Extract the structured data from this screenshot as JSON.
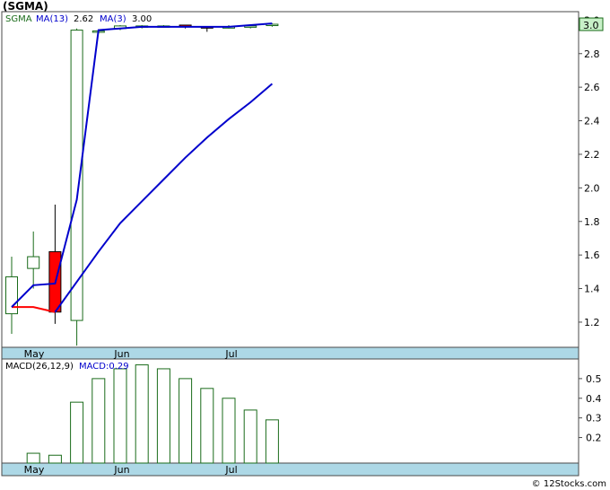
{
  "title": "(SGMA)",
  "footer": "© 12Stocks.com",
  "colors": {
    "up_candle": "#1a6b1a",
    "down_candle": "#ff0000",
    "ma_short": "#0000cc",
    "ma_long": "#0000cc",
    "price_line_recent": "#ff0000",
    "macd_bar": "#1a6b1a",
    "axis_strip": "#add8e6",
    "price_box": "#c8f0c8"
  },
  "chart_data": [
    {
      "type": "candlestick",
      "legend": {
        "symbol": "SGMA",
        "ma13_label": "MA(13)",
        "ma13_value": "2.62",
        "ma3_label": "MA(3)",
        "ma3_value": "3.00"
      },
      "current_price_label": "3.0",
      "ylim": [
        1.05,
        3.05
      ],
      "yticks": [
        "1.2",
        "1.4",
        "1.6",
        "1.8",
        "2.0",
        "2.2",
        "2.4",
        "2.6",
        "2.8",
        "3.0"
      ],
      "xticks": [
        "May",
        "Jun",
        "Jul"
      ],
      "candles": [
        {
          "o": 1.25,
          "h": 1.59,
          "l": 1.13,
          "c": 1.47
        },
        {
          "o": 1.52,
          "h": 1.74,
          "l": 1.4,
          "c": 1.59
        },
        {
          "o": 1.62,
          "h": 1.9,
          "l": 1.19,
          "c": 1.26
        },
        {
          "o": 1.21,
          "h": 2.95,
          "l": 1.06,
          "c": 2.94
        },
        {
          "o": 2.93,
          "h": 2.94,
          "l": 2.92,
          "c": 2.935
        },
        {
          "o": 2.95,
          "h": 2.97,
          "l": 2.94,
          "c": 2.965
        },
        {
          "o": 2.96,
          "h": 2.97,
          "l": 2.95,
          "c": 2.965
        },
        {
          "o": 2.965,
          "h": 2.97,
          "l": 2.96,
          "c": 2.965
        },
        {
          "o": 2.97,
          "h": 2.97,
          "l": 2.95,
          "c": 2.96
        },
        {
          "o": 2.96,
          "h": 2.96,
          "l": 2.93,
          "c": 2.955
        },
        {
          "o": 2.96,
          "h": 2.97,
          "l": 2.95,
          "c": 2.96
        },
        {
          "o": 2.96,
          "h": 2.97,
          "l": 2.95,
          "c": 2.965
        },
        {
          "o": 2.97,
          "h": 2.98,
          "l": 2.96,
          "c": 2.975
        }
      ],
      "ma3": [
        1.29,
        1.42,
        1.43,
        1.93,
        2.94,
        2.95,
        2.96,
        2.96,
        2.96,
        2.96,
        2.96,
        2.97,
        2.98
      ],
      "ma13": [
        null,
        null,
        1.26,
        1.44,
        1.62,
        1.79,
        1.92,
        2.05,
        2.18,
        2.3,
        2.41,
        2.51,
        2.62
      ],
      "red_line": [
        1.29,
        1.29,
        1.26
      ]
    },
    {
      "type": "bar",
      "legend": {
        "label": "MACD(26,12,9)",
        "value_label": "MACD:0.29"
      },
      "ylim": [
        0.07,
        0.6
      ],
      "yticks": [
        "0.2",
        "0.3",
        "0.4",
        "0.5"
      ],
      "xticks": [
        "May",
        "Jun",
        "Jul"
      ],
      "values": [
        0.0,
        0.12,
        0.11,
        0.38,
        0.5,
        0.55,
        0.57,
        0.55,
        0.5,
        0.45,
        0.4,
        0.34,
        0.29
      ]
    }
  ]
}
